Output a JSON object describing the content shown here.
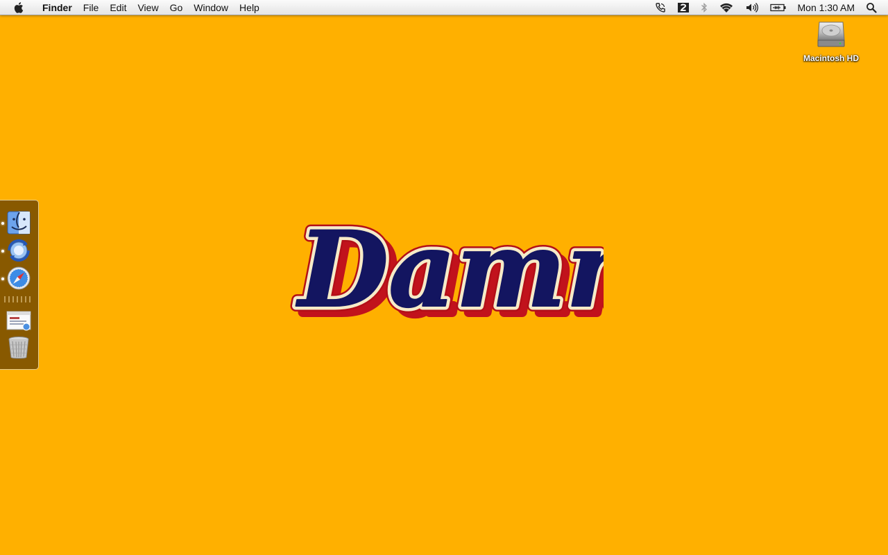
{
  "menubar": {
    "app_name": "Finder",
    "menus": [
      "File",
      "Edit",
      "View",
      "Go",
      "Window",
      "Help"
    ],
    "status_icons": [
      "phone-icon",
      "two-badge-icon",
      "bluetooth-icon",
      "wifi-icon",
      "volume-icon",
      "battery-icon"
    ],
    "clock": "Mon 1:30 AM",
    "search_icon": "spotlight-icon"
  },
  "desktop": {
    "background_color": "#FFB000",
    "icons": [
      {
        "label": "Macintosh HD",
        "icon": "hard-drive-icon"
      }
    ],
    "wallpaper_text": "Damn",
    "wallpaper_colors": {
      "fill": "#131560",
      "outline": "#F6EBC8",
      "shadow": "#C1121C"
    }
  },
  "dock": {
    "items": [
      {
        "name": "finder-icon",
        "running": true
      },
      {
        "name": "sync-icon",
        "running": true
      },
      {
        "name": "safari-icon",
        "running": true
      },
      {
        "name": "documents-stack-icon",
        "running": false
      },
      {
        "name": "trash-icon",
        "running": false
      }
    ]
  }
}
